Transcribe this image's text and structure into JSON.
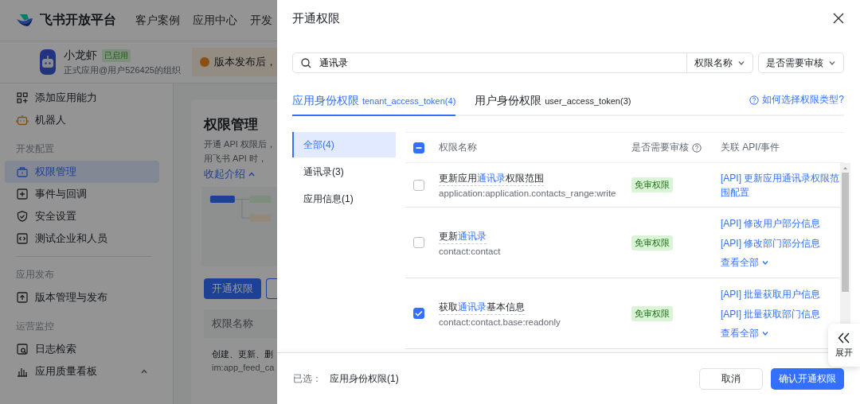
{
  "nav": {
    "brand": "飞书开放平台",
    "links": [
      "客户案例",
      "应用中心",
      "开发"
    ]
  },
  "app": {
    "name": "小龙虾",
    "status": "已启用",
    "org": "正式应用@用户526425的组织",
    "notice": "版本发布后，"
  },
  "sidebar": [
    {
      "items": [
        {
          "label": "添加应用能力",
          "selected": false
        },
        {
          "label": "机器人",
          "selected": false
        }
      ]
    },
    {
      "title": "开发配置",
      "items": [
        {
          "label": "权限管理",
          "selected": true
        },
        {
          "label": "事件与回调",
          "selected": false
        },
        {
          "label": "安全设置",
          "selected": false
        },
        {
          "label": "测试企业和人员",
          "selected": false
        }
      ]
    },
    {
      "title": "应用发布",
      "items": [
        {
          "label": "版本管理与发布",
          "selected": false
        }
      ]
    },
    {
      "title": "运营监控",
      "items": [
        {
          "label": "日志检索",
          "selected": false
        },
        {
          "label": "应用质量看板",
          "selected": false,
          "expanded": true
        }
      ]
    }
  ],
  "main": {
    "title": "权限管理",
    "intro": [
      "开通 API 权限后，",
      "用飞书 API 时，"
    ],
    "collapse_link": "收起介绍",
    "primary_button": "开通权限",
    "table_header": "权限名称",
    "row": [
      "创建、更新、删",
      "im:app_feed_ca"
    ]
  },
  "drawer": {
    "title": "开通权限",
    "search": {
      "value": "通讯录",
      "field_select": "权限名称",
      "review_select": "是否需要审核"
    },
    "tabs": [
      {
        "label": "应用身份权限",
        "token": "tenant_access_token(4)",
        "selected": true
      },
      {
        "label": "用户身份权限",
        "token": "user_access_token(3)",
        "selected": false
      }
    ],
    "help_link": "如何选择权限类型?",
    "categories": [
      {
        "label": "全部(4)",
        "selected": true
      },
      {
        "label": "通讯录(3)",
        "selected": false
      },
      {
        "label": "应用信息(1)",
        "selected": false
      }
    ],
    "table": {
      "select_all_indeterminate": true,
      "columns": [
        "权限名称",
        "是否需要审核",
        "关联 API/事件"
      ],
      "rows": [
        {
          "name": [
            {
              "text": "更新应用",
              "match": false
            },
            {
              "text": "通讯录",
              "match": true
            },
            {
              "text": "权限范围",
              "match": false
            }
          ],
          "scope": "application:application.contacts_range:write",
          "review": "免审权限",
          "apis": [
            "[API] 更新应用通讯录权限范围配置"
          ],
          "checked": false
        },
        {
          "name": [
            {
              "text": "更新",
              "match": false
            },
            {
              "text": "通讯录",
              "match": true
            }
          ],
          "scope": "contact:contact",
          "review": "免审权限",
          "apis": [
            "[API] 修改用户部分信息",
            "[API] 修改部门部分信息"
          ],
          "more": "查看全部",
          "checked": false
        },
        {
          "name": [
            {
              "text": "获取",
              "match": false
            },
            {
              "text": "通讯录",
              "match": true
            },
            {
              "text": "基本信息",
              "match": false
            }
          ],
          "scope": "contact:contact.base:readonly",
          "review": "免审权限",
          "apis": [
            "[API] 批量获取用户信息",
            "[API] 批量获取部门信息"
          ],
          "more": "查看全部",
          "checked": true
        }
      ]
    },
    "selected_label": "已选：",
    "selected_value": "应用身份权限(1)",
    "buttons": [
      {
        "label": "取消",
        "kind": "secondary"
      },
      {
        "label": "确认开通权限",
        "kind": "primary"
      }
    ]
  },
  "expand_button": "展开"
}
